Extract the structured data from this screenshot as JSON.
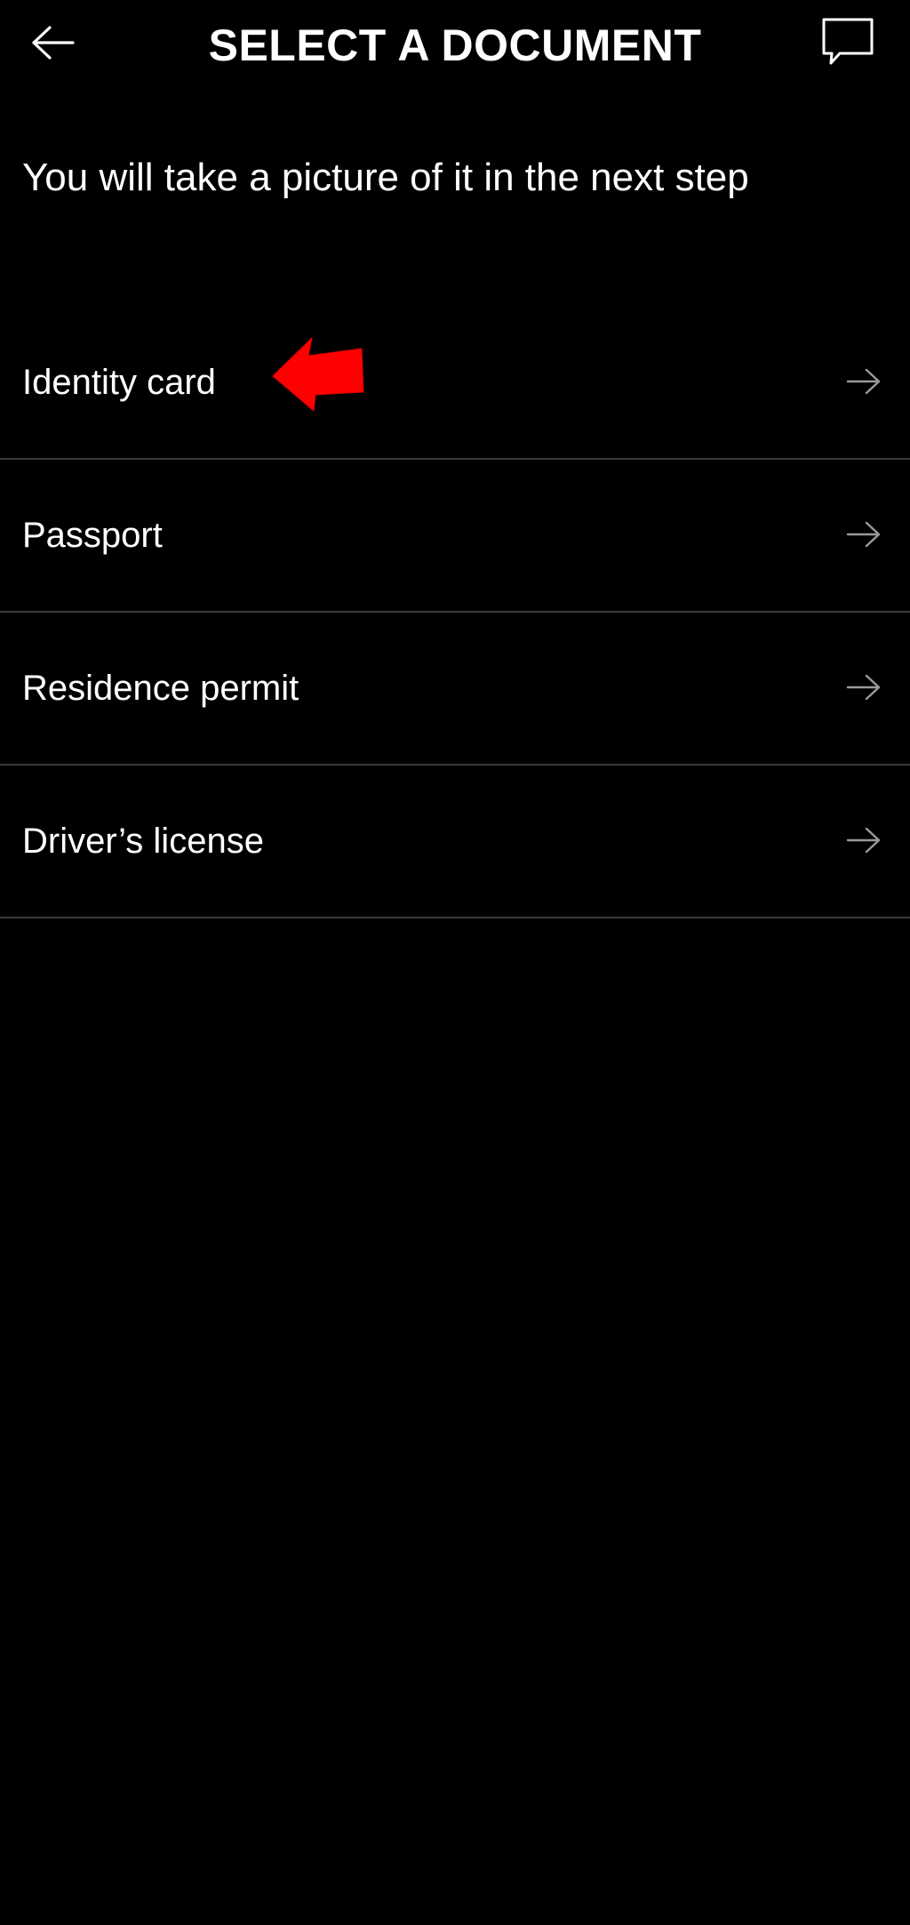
{
  "header": {
    "title": "SELECT A DOCUMENT",
    "back_icon": "arrow-left-icon",
    "chat_icon": "chat-bubble-icon"
  },
  "subtitle": "You will take a picture of it in the next step",
  "documents": [
    {
      "label": "Identity card",
      "icon": "arrow-right-icon"
    },
    {
      "label": "Passport",
      "icon": "arrow-right-icon"
    },
    {
      "label": "Residence permit",
      "icon": "arrow-right-icon"
    },
    {
      "label": "Driver’s license",
      "icon": "arrow-right-icon"
    }
  ],
  "annotation": {
    "icon": "red-pointer-arrow-icon",
    "color": "#ff0000"
  },
  "colors": {
    "background": "#000000",
    "text": "#ffffff",
    "divider": "#3a3a3a",
    "row_arrow": "#9a9a9a"
  }
}
